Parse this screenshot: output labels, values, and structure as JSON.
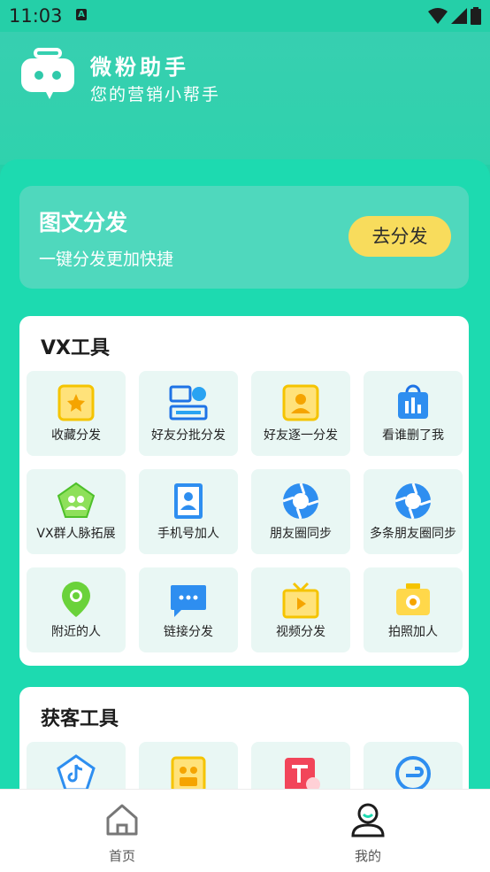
{
  "status_bar": {
    "time": "11:03",
    "indicator": "A"
  },
  "header": {
    "app_name": "微粉助手",
    "tagline": "您的营销小帮手"
  },
  "promo": {
    "title": "图文分发",
    "subtitle": "一键分发更加快捷",
    "button_label": "去分发"
  },
  "vx_tools": {
    "title": "VX工具",
    "items": [
      {
        "label": "收藏分发",
        "icon": "star-badge-icon"
      },
      {
        "label": "好友分批分发",
        "icon": "friend-cards-icon"
      },
      {
        "label": "好友逐一分发",
        "icon": "contact-card-icon"
      },
      {
        "label": "看谁删了我",
        "icon": "bag-chart-icon"
      },
      {
        "label": "VX群人脉拓展",
        "icon": "group-pentagon-icon"
      },
      {
        "label": "手机号加人",
        "icon": "phone-contact-icon"
      },
      {
        "label": "朋友圈同步",
        "icon": "aperture-icon"
      },
      {
        "label": "多条朋友圈同步",
        "icon": "aperture-icon"
      },
      {
        "label": "附近的人",
        "icon": "location-pin-icon"
      },
      {
        "label": "链接分发",
        "icon": "chat-bubble-icon"
      },
      {
        "label": "视频分发",
        "icon": "tv-play-icon"
      },
      {
        "label": "拍照加人",
        "icon": "camera-icon"
      }
    ]
  },
  "lead_tools": {
    "title": "获客工具",
    "items": [
      {
        "label": "",
        "icon": "tiktok-pentagon-icon"
      },
      {
        "label": "",
        "icon": "kuaishou-icon"
      },
      {
        "label": "",
        "icon": "red-book-icon"
      },
      {
        "label": "",
        "icon": "circle-arrow-icon"
      }
    ]
  },
  "tabs": [
    {
      "label": "首页",
      "icon": "home-icon"
    },
    {
      "label": "我的",
      "icon": "user-icon"
    }
  ],
  "colors": {
    "accent": "#1ddab0",
    "button": "#f8dc5c",
    "tile_bg": "#e9f7f4"
  }
}
